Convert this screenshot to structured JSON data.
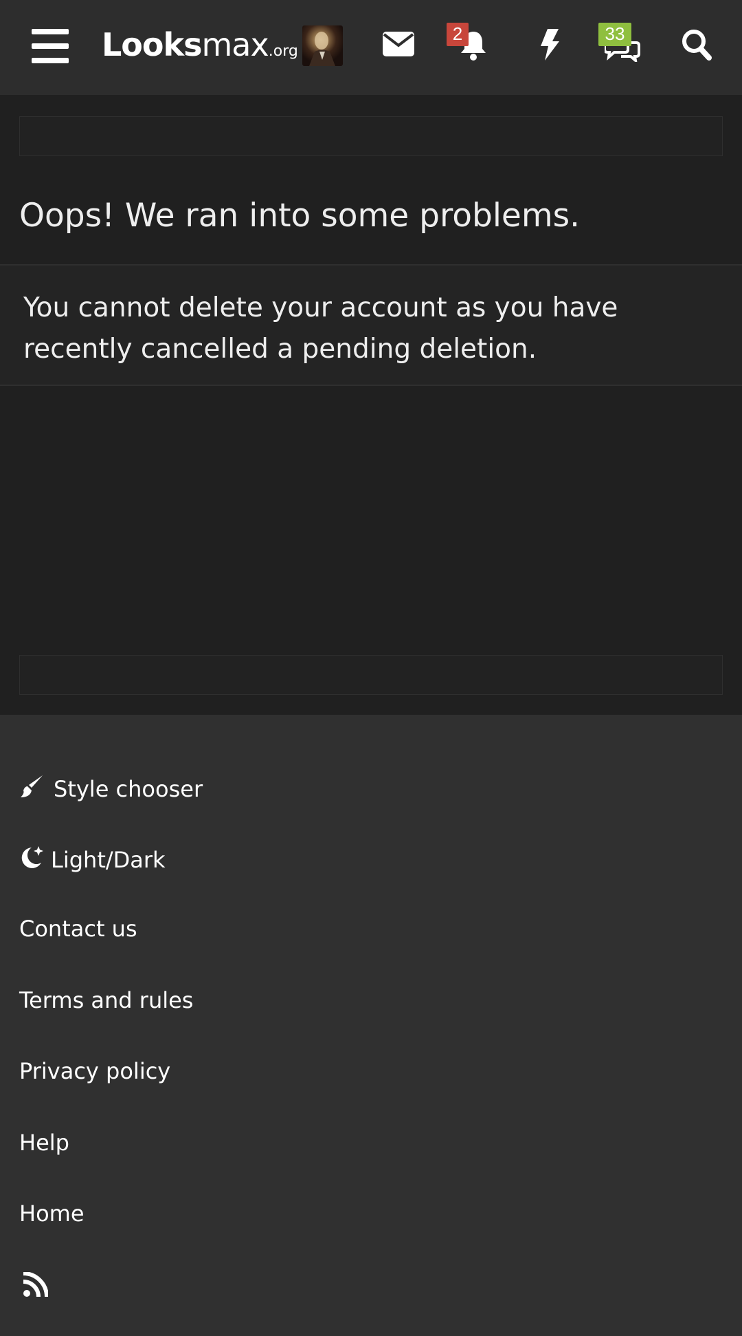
{
  "header": {
    "menu_icon": "hamburger-icon",
    "logo": {
      "main_bold": "Looks",
      "main_light": "max",
      "tld": ".org"
    },
    "avatar": "user-avatar",
    "icons": [
      "envelope-icon",
      "bell-icon",
      "bolt-icon",
      "chat-bubbles-icon",
      "search-icon"
    ],
    "notifications_badge": "2",
    "conversations_badge": "33",
    "colors": {
      "bar": "#2d2d2d",
      "red_badge": "#c8463b",
      "green_badge": "#8fbf3f"
    }
  },
  "error": {
    "title": "Oops! We ran into some problems.",
    "message": "You cannot delete your account as you have recently cancelled a pending deletion."
  },
  "footer": {
    "items": [
      {
        "label": "Style chooser",
        "icon": "paintbrush-icon"
      },
      {
        "label": "Light/Dark",
        "icon": "moon-stars-icon"
      },
      {
        "label": "Contact us"
      },
      {
        "label": "Terms and rules"
      },
      {
        "label": "Privacy policy"
      },
      {
        "label": "Help"
      },
      {
        "label": "Home"
      }
    ],
    "rss_icon": "rss-icon"
  }
}
